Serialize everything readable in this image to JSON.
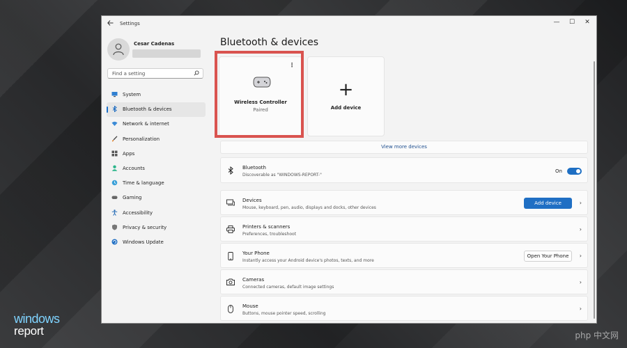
{
  "window": {
    "title": "Settings",
    "controls": {
      "minimize": "—",
      "maximize": "☐",
      "close": "✕"
    }
  },
  "profile": {
    "name": "Cesar Cadenas"
  },
  "search": {
    "placeholder": "Find a setting"
  },
  "nav": {
    "items": [
      {
        "label": "System",
        "icon": "monitor-icon",
        "active": false
      },
      {
        "label": "Bluetooth & devices",
        "icon": "bluetooth-icon",
        "active": true
      },
      {
        "label": "Network & internet",
        "icon": "wifi-icon",
        "active": false
      },
      {
        "label": "Personalization",
        "icon": "brush-icon",
        "active": false
      },
      {
        "label": "Apps",
        "icon": "apps-icon",
        "active": false
      },
      {
        "label": "Accounts",
        "icon": "person-icon",
        "active": false
      },
      {
        "label": "Time & language",
        "icon": "globe-clock-icon",
        "active": false
      },
      {
        "label": "Gaming",
        "icon": "gamepad-icon",
        "active": false
      },
      {
        "label": "Accessibility",
        "icon": "accessibility-icon",
        "active": false
      },
      {
        "label": "Privacy & security",
        "icon": "shield-icon",
        "active": false
      },
      {
        "label": "Windows Update",
        "icon": "update-icon",
        "active": false
      }
    ]
  },
  "page": {
    "title": "Bluetooth & devices"
  },
  "device_tile": {
    "name": "Wireless Controller",
    "status": "Paired",
    "menu": "⋮"
  },
  "add_tile": {
    "plus": "+",
    "label": "Add device"
  },
  "view_more": "View more devices",
  "bluetooth": {
    "title": "Bluetooth",
    "subtitle": "Discoverable as \"WINDOWS-REPORT-\"",
    "state": "On",
    "enabled": true
  },
  "rows": [
    {
      "id": "devices",
      "title": "Devices",
      "subtitle": "Mouse, keyboard, pen, audio, displays and docks, other devices",
      "icon": "devices-icon",
      "button": "Add device"
    },
    {
      "id": "printers",
      "title": "Printers & scanners",
      "subtitle": "Preferences, troubleshoot",
      "icon": "printer-icon"
    },
    {
      "id": "phone",
      "title": "Your Phone",
      "subtitle": "Instantly access your Android device's photos, texts, and more",
      "icon": "phone-icon",
      "button": "Open Your Phone"
    },
    {
      "id": "cameras",
      "title": "Cameras",
      "subtitle": "Connected cameras, default image settings",
      "icon": "camera-icon"
    },
    {
      "id": "mouse",
      "title": "Mouse",
      "subtitle": "Buttons, mouse pointer speed, scrolling",
      "icon": "mouse-icon"
    }
  ],
  "branding": {
    "logo_line1": "windows",
    "logo_line2": "report",
    "watermark": "php 中文网"
  },
  "colors": {
    "accent": "#1f6fc4",
    "highlight": "#d9534f",
    "window_bg": "#f3f3f3"
  }
}
